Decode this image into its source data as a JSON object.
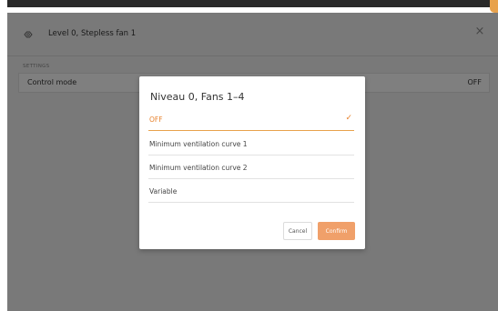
{
  "window": {
    "title": "Level 0, Stepless fan 1",
    "icon": "device-icon",
    "close_icon": "close-icon"
  },
  "settings": {
    "section_label": "SETTINGS",
    "control_mode": {
      "label": "Control mode",
      "value": "OFF"
    }
  },
  "dialog": {
    "title": "Niveau 0, Fans 1–4",
    "options": [
      {
        "label": "OFF",
        "selected": true
      },
      {
        "label": "Minimum ventilation curve 1",
        "selected": false
      },
      {
        "label": "Minimum ventilation curve 2",
        "selected": false
      },
      {
        "label": "Variable",
        "selected": false
      }
    ],
    "cancel_label": "Cancel",
    "confirm_label": "Confirm"
  },
  "colors": {
    "accent": "#e8822c",
    "confirm_bg": "#f0a06a",
    "overlay": "rgba(0,0,0,0.5)"
  }
}
